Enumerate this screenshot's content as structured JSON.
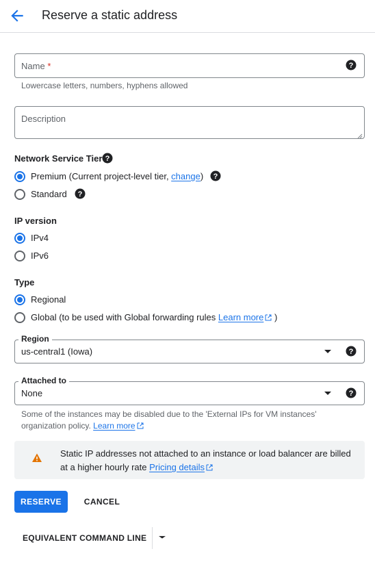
{
  "header": {
    "title": "Reserve a static address"
  },
  "name_field": {
    "label": "Name",
    "required_mark": "*",
    "hint": "Lowercase letters, numbers, hyphens allowed"
  },
  "description_field": {
    "placeholder": "Description"
  },
  "network_tier": {
    "label": "Network Service Tier",
    "premium_label": "Premium (Current project-level tier, ",
    "premium_link": "change",
    "premium_suffix": ")",
    "standard_label": "Standard",
    "selected": "Premium"
  },
  "ip_version": {
    "label": "IP version",
    "options": [
      "IPv4",
      "IPv6"
    ],
    "selected": "IPv4"
  },
  "type": {
    "label": "Type",
    "regional_label": "Regional",
    "global_label": "Global (to be used with Global forwarding rules ",
    "global_link": "Learn more",
    "global_suffix": " )",
    "selected": "Regional"
  },
  "region": {
    "label": "Region",
    "value": "us-central1 (Iowa)"
  },
  "attached_to": {
    "label": "Attached to",
    "value": "None",
    "hint_line1": "Some of the instances may be disabled due to the 'External IPs for VM instances'",
    "hint_line2": "organization policy. ",
    "hint_link": "Learn more"
  },
  "warning": {
    "line1": "Static IP addresses not attached to an instance or load balancer are billed",
    "line2": "at a higher hourly rate ",
    "link": "Pricing details",
    "icon_color": "#e37400"
  },
  "actions": {
    "reserve": "RESERVE",
    "cancel": "CANCEL",
    "equivalent": "EQUIVALENT COMMAND LINE"
  },
  "colors": {
    "accent": "#1a73e8",
    "text": "#202124",
    "muted": "#5f6368"
  }
}
